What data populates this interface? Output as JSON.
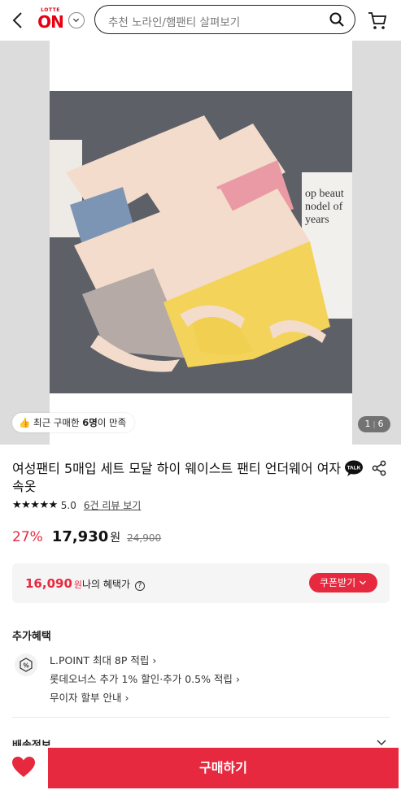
{
  "header": {
    "logo_small": "LOTTE",
    "logo_big": "ON",
    "search_placeholder": "추천 노라인/햄팬티 살펴보기"
  },
  "gallery": {
    "social_proof_prefix": "최근 구매한 ",
    "social_proof_count": "6명",
    "social_proof_suffix": "이 만족",
    "photo_text": "op beaut\nnodel of\nyears",
    "counter_current": "1",
    "counter_total": "6"
  },
  "product": {
    "title": "여성팬티 5매입 세트 모달 하이 웨이스트 팬티 언더웨어 여자속옷",
    "talk_label": "TALK",
    "stars": "★★★★★",
    "rating": "5.0",
    "review_link": "6건 리뷰 보기",
    "rating_value": 5.0
  },
  "price": {
    "discount": "27%",
    "final": "17,930",
    "won": "원",
    "original": "24,900"
  },
  "benefit_box": {
    "price": "16,090",
    "won": "원",
    "label": "나의 혜택가",
    "info_icon": "?",
    "coupon_button": "쿠폰받기"
  },
  "extra_benefits": {
    "title": "추가혜택",
    "icon_label": "%",
    "lines": [
      "L.POINT 최대 8P 적립",
      "롯데오너스 추가 1% 할인·추가 0.5% 적립",
      "무이자 할부 안내"
    ]
  },
  "shipping": {
    "title": "배송정보"
  },
  "bottom": {
    "buy_label": "구매하기"
  },
  "colors": {
    "brand": "#e60012",
    "accent": "#e6293e"
  }
}
